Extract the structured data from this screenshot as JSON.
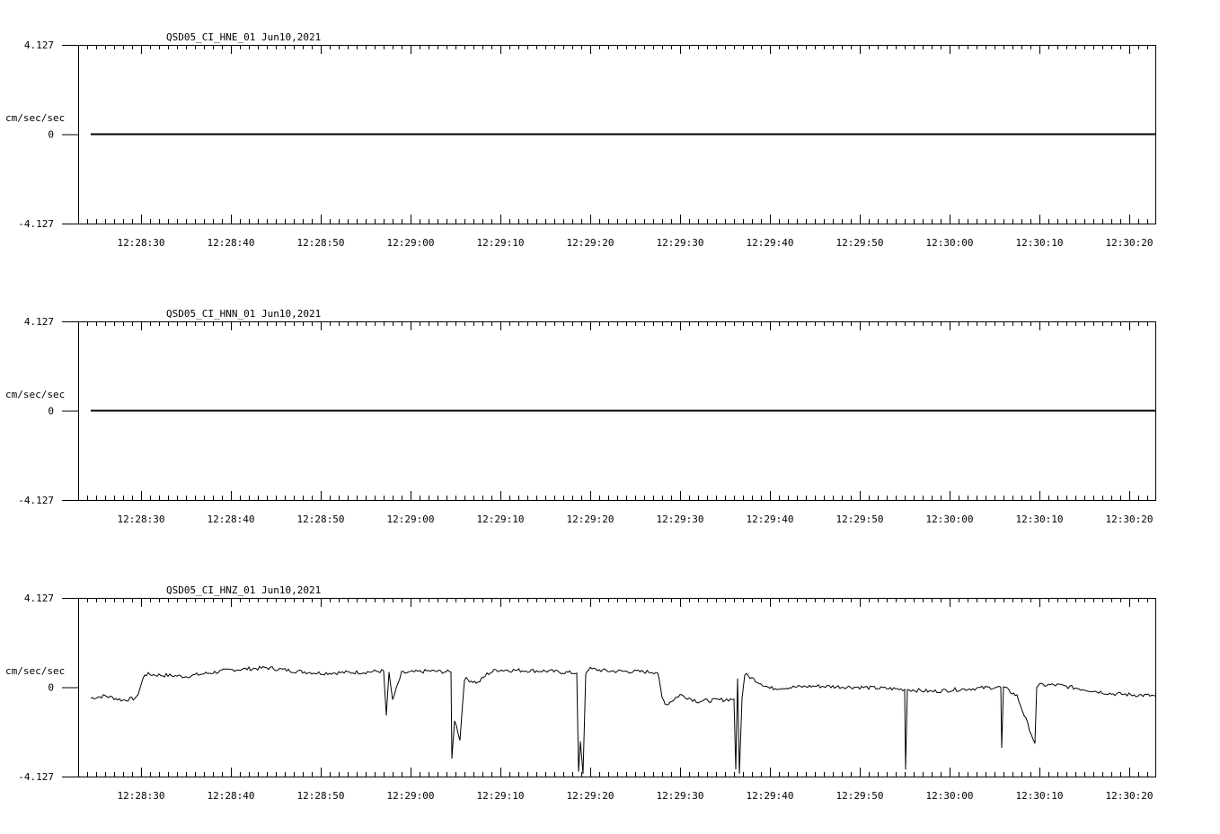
{
  "chart_data": [
    {
      "type": "line",
      "title": "QSD05_CI_HNE_01  Jun10,2021",
      "ylabel": "cm/sec/sec",
      "ylim": [
        -4.127,
        4.127
      ],
      "yticks": [
        "4.127",
        "0",
        "-4.127"
      ],
      "xticks": [
        "12:28:30",
        "12:28:40",
        "12:28:50",
        "12:29:00",
        "12:29:10",
        "12:29:20",
        "12:29:30",
        "12:29:40",
        "12:29:50",
        "12:30:00",
        "12:30:10",
        "12:30:20"
      ],
      "series": [
        {
          "x_start": "12:28:24.4",
          "x_end": "12:30:22.9",
          "values": [
            0,
            0
          ]
        }
      ]
    },
    {
      "type": "line",
      "title": "QSD05_CI_HNN_01  Jun10,2021",
      "ylabel": "cm/sec/sec",
      "ylim": [
        -4.127,
        4.127
      ],
      "yticks": [
        "4.127",
        "0",
        "-4.127"
      ],
      "xticks": [
        "12:28:30",
        "12:28:40",
        "12:28:50",
        "12:29:00",
        "12:29:10",
        "12:29:20",
        "12:29:30",
        "12:29:40",
        "12:29:50",
        "12:30:00",
        "12:30:10",
        "12:30:20"
      ],
      "series": [
        {
          "x_start": "12:28:24.4",
          "x_end": "12:30:22.9",
          "values": [
            0,
            0
          ]
        }
      ]
    },
    {
      "type": "line",
      "title": "QSD05_CI_HNZ_01  Jun10,2021",
      "ylabel": "cm/sec/sec",
      "ylim": [
        -4.127,
        4.127
      ],
      "yticks": [
        "4.127",
        "0",
        "-4.127"
      ],
      "xticks": [
        "12:28:30",
        "12:28:40",
        "12:28:50",
        "12:29:00",
        "12:29:10",
        "12:29:20",
        "12:29:30",
        "12:29:40",
        "12:29:50",
        "12:30:00",
        "12:30:10",
        "12:30:20"
      ],
      "series": [
        {
          "t": [
            "12:28:24.4",
            "12:28:26.0",
            "12:28:28.0",
            "12:28:29.5",
            "12:28:30.4",
            "12:28:35.0",
            "12:28:40.0",
            "12:28:44.0",
            "12:28:47.0",
            "12:28:50.0",
            "12:28:55.0",
            "12:28:57.0",
            "12:28:57.3",
            "12:28:57.6",
            "12:28:58.0",
            "12:28:59.0",
            "12:29:02.0",
            "12:29:04.5",
            "12:29:04.6",
            "12:29:04.9",
            "12:29:05.5",
            "12:29:06.0",
            "12:29:07.5",
            "12:29:08.5",
            "12:29:09.5",
            "12:29:15.0",
            "12:29:18.5",
            "12:29:18.7",
            "12:29:18.9",
            "12:29:19.2",
            "12:29:19.5",
            "12:29:19.8",
            "12:29:22.0",
            "12:29:27.5",
            "12:29:28.0",
            "12:29:28.5",
            "12:29:30.0",
            "12:29:32.0",
            "12:29:36.0",
            "12:29:36.2",
            "12:29:36.4",
            "12:29:36.6",
            "12:29:36.9",
            "12:29:37.2",
            "12:29:40.0",
            "12:29:45.0",
            "12:29:50.0",
            "12:29:55.0",
            "12:29:55.1",
            "12:29:55.3",
            "12:29:58.0",
            "12:30:01.0",
            "12:30:05.0",
            "12:30:05.7",
            "12:30:05.8",
            "12:30:06.0",
            "12:30:07.5",
            "12:30:09.5",
            "12:30:09.7",
            "12:30:10.0",
            "12:30:12.0",
            "12:30:15.0",
            "12:30:18.0",
            "12:30:22.9"
          ],
          "values": [
            -0.5,
            -0.4,
            -0.6,
            -0.5,
            0.6,
            0.5,
            0.8,
            0.9,
            0.75,
            0.65,
            0.7,
            0.75,
            -1.3,
            0.7,
            -0.6,
            0.65,
            0.75,
            0.7,
            -3.3,
            -1.5,
            -2.4,
            0.4,
            0.2,
            0.6,
            0.8,
            0.75,
            0.65,
            -3.9,
            -2.5,
            -4.0,
            0.6,
            0.85,
            0.75,
            0.7,
            -0.5,
            -0.8,
            -0.35,
            -0.65,
            -0.55,
            -3.8,
            0.4,
            -4.0,
            -0.5,
            0.6,
            -0.05,
            0.05,
            0.0,
            -0.1,
            -3.8,
            -0.1,
            -0.2,
            -0.1,
            0.0,
            0.0,
            -2.8,
            0.0,
            -0.4,
            -2.6,
            0.0,
            0.1,
            0.1,
            -0.1,
            -0.3,
            -0.4
          ]
        }
      ]
    }
  ]
}
